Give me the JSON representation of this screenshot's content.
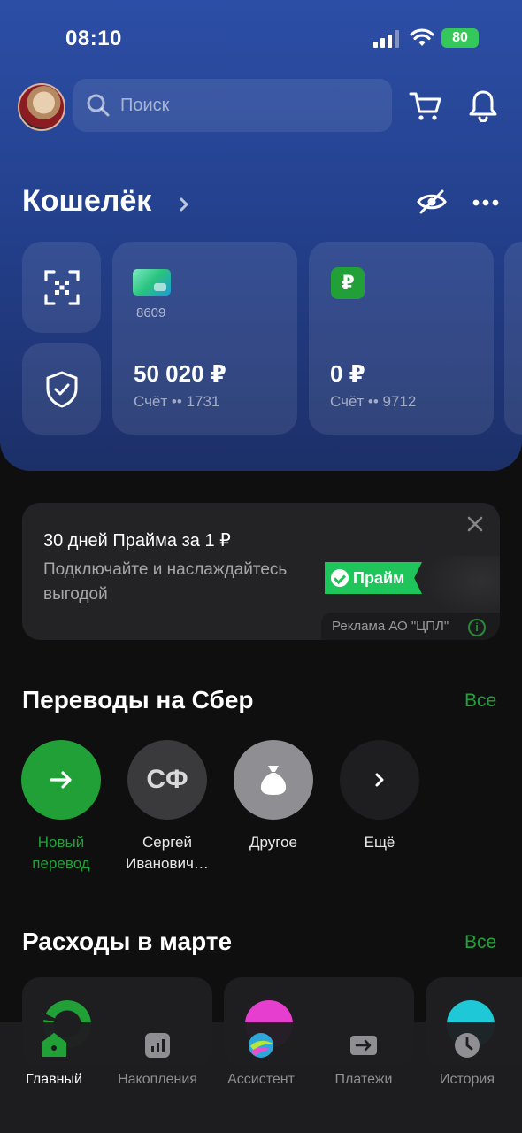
{
  "status_bar": {
    "time": "08:10",
    "battery": "80"
  },
  "header": {
    "search_placeholder": "Поиск"
  },
  "wallet": {
    "title": "Кошелёк",
    "cards": [
      {
        "number": "8609",
        "amount": "50 020 ₽",
        "account": "Счёт •• 1731"
      },
      {
        "badge": "₽",
        "amount": "0 ₽",
        "account": "Счёт •• 9712"
      }
    ]
  },
  "ad": {
    "title": "30 дней Прайма за 1 ₽",
    "subtitle": "Подключайте и наслаждайтесь выгодой",
    "prime_label": "Прайм",
    "ad_label": "Реклама АО \"ЦПЛ\"",
    "info": "i"
  },
  "transfers": {
    "title": "Переводы на Сбер",
    "all": "Все",
    "items": [
      {
        "label": "Новый перевод"
      },
      {
        "initials": "СФ",
        "label": "Сергей Иванович…"
      },
      {
        "label": "Другое"
      },
      {
        "label": "Ещё"
      }
    ]
  },
  "expenses": {
    "title": "Расходы в марте",
    "all": "Все"
  },
  "nav": {
    "items": [
      {
        "label": "Главный"
      },
      {
        "label": "Накопления"
      },
      {
        "label": "Ассистент"
      },
      {
        "label": "Платежи"
      },
      {
        "label": "История"
      }
    ]
  },
  "colors": {
    "accent": "#21a038",
    "hero_top": "#2c4ea6",
    "hero_bottom": "#1c2f68",
    "background": "#0f0f10"
  }
}
